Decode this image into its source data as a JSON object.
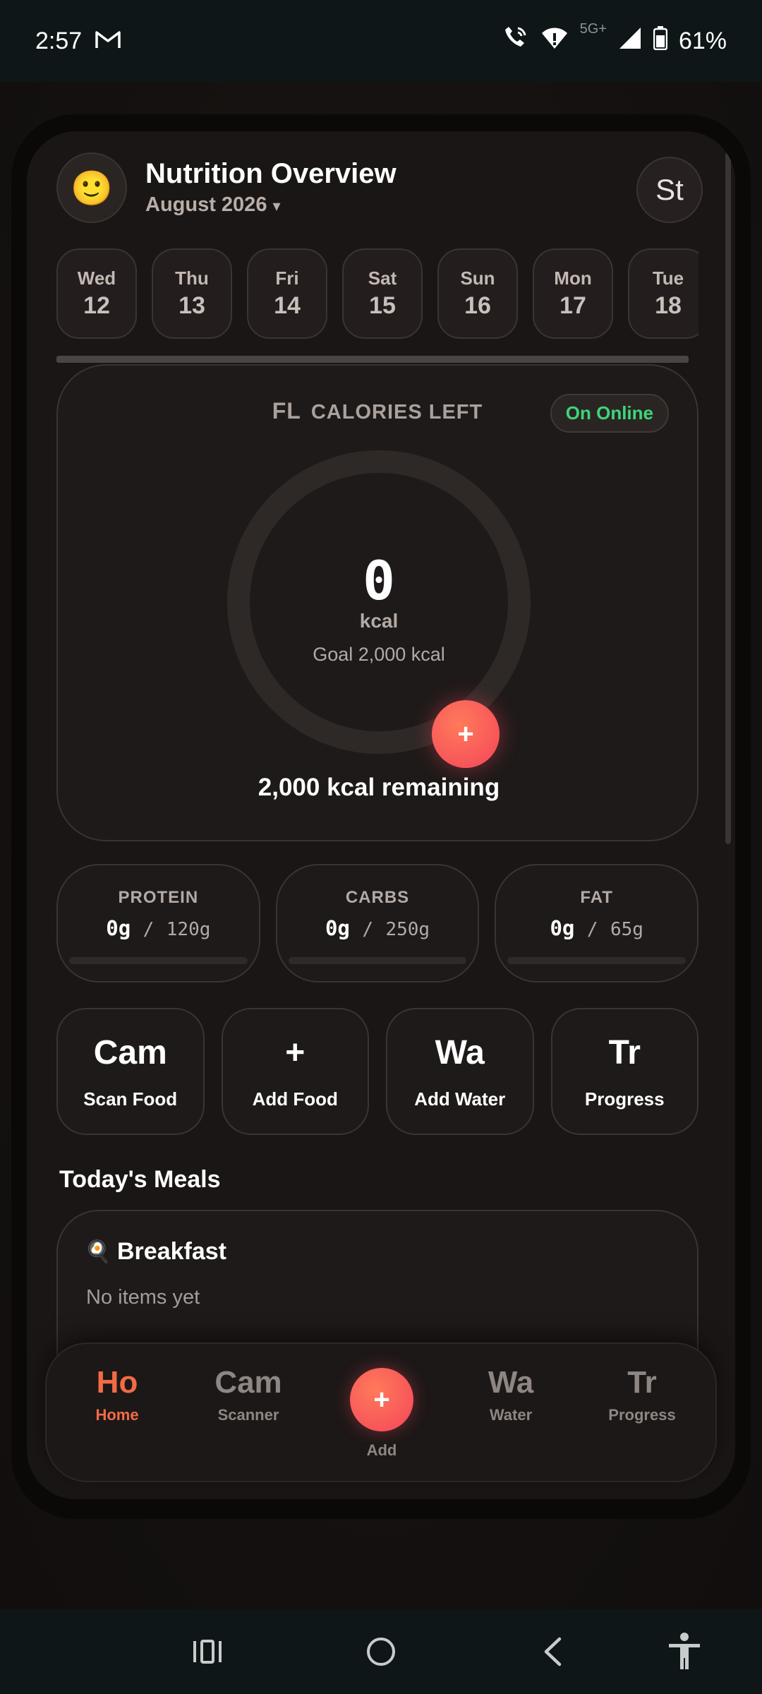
{
  "status": {
    "time": "2:57",
    "network": "5G+",
    "battery": "61%"
  },
  "header": {
    "avatar_emoji": "🙂",
    "title": "Nutrition Overview",
    "month": "August 2026",
    "dropdown_glyph": "▾",
    "st_label": "St"
  },
  "days": [
    {
      "name": "Wed",
      "num": "12"
    },
    {
      "name": "Thu",
      "num": "13"
    },
    {
      "name": "Fri",
      "num": "14"
    },
    {
      "name": "Sat",
      "num": "15"
    },
    {
      "name": "Sun",
      "num": "16"
    },
    {
      "name": "Mon",
      "num": "17"
    },
    {
      "name": "Tue",
      "num": "18"
    }
  ],
  "calories": {
    "icon_text": "FL",
    "heading": "CALORIES LEFT",
    "online_badge": "On Online",
    "value": "0",
    "unit": "kcal",
    "goal": "Goal 2,000 kcal",
    "add_glyph": "+",
    "remaining": "2,000 kcal remaining",
    "progress_fraction": 0
  },
  "macros": [
    {
      "label": "PROTEIN",
      "current": "0g",
      "separator": "/",
      "goal": "120g",
      "fraction": 0
    },
    {
      "label": "CARBS",
      "current": "0g",
      "separator": "/",
      "goal": "250g",
      "fraction": 0
    },
    {
      "label": "FAT",
      "current": "0g",
      "separator": "/",
      "goal": "65g",
      "fraction": 0
    }
  ],
  "actions": [
    {
      "icon": "Cam",
      "label": "Scan Food"
    },
    {
      "icon": "+",
      "label": "Add Food"
    },
    {
      "icon": "Wa",
      "label": "Add Water"
    },
    {
      "icon": "Tr",
      "label": "Progress"
    }
  ],
  "meals": {
    "title": "Today's Meals",
    "breakfast": {
      "icon": "🍳",
      "name": "Breakfast",
      "empty": "No items yet"
    }
  },
  "nav": {
    "home": {
      "icon": "Ho",
      "label": "Home"
    },
    "scanner": {
      "icon": "Cam",
      "label": "Scanner"
    },
    "add": {
      "icon": "+",
      "label": "Add"
    },
    "water": {
      "icon": "Wa",
      "label": "Water"
    },
    "progress": {
      "icon": "Tr",
      "label": "Progress"
    }
  },
  "colors": {
    "accent": "#f26b45",
    "online_green": "#3ed57a",
    "fab_gradient_start": "#ff7a5a",
    "fab_gradient_end": "#f4455a"
  }
}
